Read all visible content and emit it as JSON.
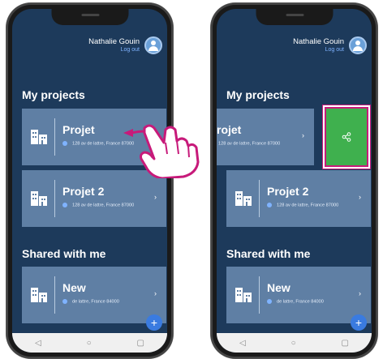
{
  "user": {
    "name": "Nathalie Gouin",
    "logout": "Log out"
  },
  "sections": {
    "projects": "My projects",
    "shared": "Shared with me"
  },
  "left_cards": [
    {
      "title": "Projet",
      "address": "128 av de lattre, France  87000"
    },
    {
      "title": "Projet 2",
      "address": "128 av de lattre, France  87000"
    },
    {
      "title": "New",
      "address": "de lattre, France  84000"
    }
  ],
  "right_cards": [
    {
      "title": "rojet",
      "address": "128 av de lattre, France  87000"
    },
    {
      "title": "Projet 2",
      "address": "128 av de lattre, France  87000"
    },
    {
      "title": "New",
      "address": "de lattre, France  84000"
    }
  ],
  "icons": {
    "chevron": "›",
    "fab": "+",
    "nav_back": "◁",
    "nav_home": "○",
    "nav_recent": "▢",
    "share": "share-icon"
  },
  "colors": {
    "screen_bg": "#1d3a5b",
    "card_bg": "#5f7fa4",
    "share_green": "#3fb04e",
    "highlight_magenta": "#c71a7a",
    "fab_blue": "#3a7be0"
  }
}
